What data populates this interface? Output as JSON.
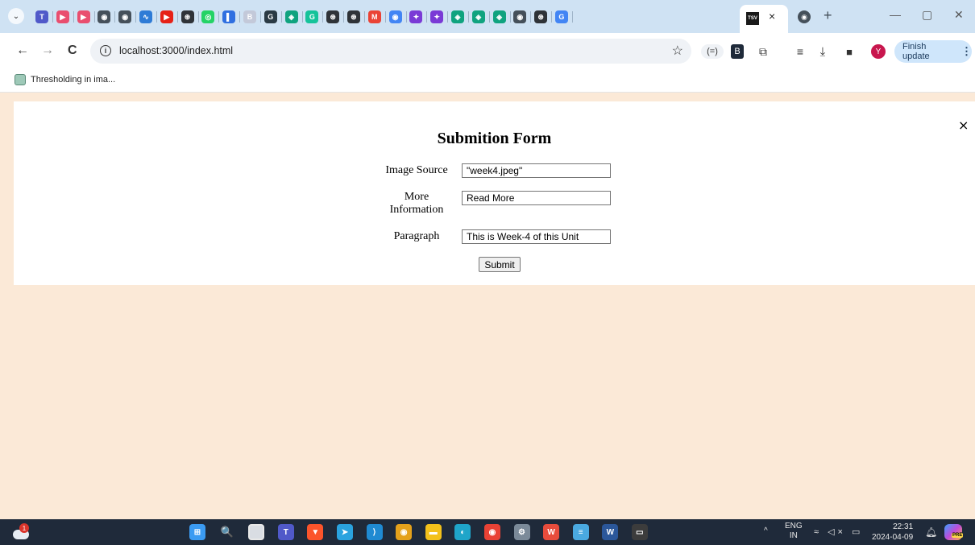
{
  "browser": {
    "tabs": {
      "favicons": [
        {
          "icon": "ms-teams-icon",
          "glyph": "T",
          "color": "#5059c9"
        },
        {
          "icon": "youtube-play-icon",
          "glyph": "▶",
          "color": "#e94e6f"
        },
        {
          "icon": "youtube-play-icon",
          "glyph": "▶",
          "color": "#e94e6f"
        },
        {
          "icon": "globe-icon",
          "glyph": "◉",
          "color": "#45505a"
        },
        {
          "icon": "globe-icon",
          "glyph": "◉",
          "color": "#45505a"
        },
        {
          "icon": "wave-icon",
          "glyph": "∿",
          "color": "#2e7bd6"
        },
        {
          "icon": "youtube-icon",
          "glyph": "▶",
          "color": "#e62117"
        },
        {
          "icon": "openai-icon",
          "glyph": "⊛",
          "color": "#2f3338"
        },
        {
          "icon": "whatsapp-icon",
          "glyph": "◎",
          "color": "#25d366"
        },
        {
          "icon": "bookmark-icon",
          "glyph": "▌",
          "color": "#2f6fe0"
        },
        {
          "icon": "bing-icon",
          "glyph": "B",
          "color": "#c3c9d9"
        },
        {
          "icon": "grammarly-icon",
          "glyph": "G",
          "color": "#2a3a44"
        },
        {
          "icon": "chatgpt-icon",
          "glyph": "◈",
          "color": "#10a37f"
        },
        {
          "icon": "grammarly-icon",
          "glyph": "G",
          "color": "#15c39a"
        },
        {
          "icon": "openai-icon",
          "glyph": "⊛",
          "color": "#2f3338"
        },
        {
          "icon": "openai-icon",
          "glyph": "⊛",
          "color": "#2f3338"
        },
        {
          "icon": "gmail-icon",
          "glyph": "M",
          "color": "#ea4335"
        },
        {
          "icon": "chrome-icon",
          "glyph": "◉",
          "color": "#4285f4"
        },
        {
          "icon": "copilot-icon",
          "glyph": "✦",
          "color": "#7a3ad6"
        },
        {
          "icon": "copilot-icon",
          "glyph": "✦",
          "color": "#7a3ad6"
        },
        {
          "icon": "chatgpt-icon",
          "glyph": "◈",
          "color": "#10a37f"
        },
        {
          "icon": "chatgpt-icon",
          "glyph": "◈",
          "color": "#10a37f"
        },
        {
          "icon": "chatgpt-icon",
          "glyph": "◈",
          "color": "#10a37f"
        },
        {
          "icon": "globe-icon",
          "glyph": "◉",
          "color": "#45505a"
        },
        {
          "icon": "openai-icon",
          "glyph": "⊛",
          "color": "#2f3338"
        },
        {
          "icon": "google-icon",
          "glyph": "G",
          "color": "#4285f4"
        }
      ],
      "active_tab": {
        "favicon_text": "TSV",
        "close": "×"
      },
      "new_tab": "+",
      "window_controls": {
        "minimize": "—",
        "restore": "▢",
        "close": "✕"
      }
    },
    "toolbar": {
      "back": "←",
      "forward": "→",
      "reload": "C",
      "url": "localhost:3000/index.html",
      "star": "☆",
      "finish_update": "Finish update",
      "finish_update_menu": "⋮",
      "profile_initial": "Y"
    },
    "bookmarks": {
      "items": [
        {
          "label": "Thresholding in ima..."
        }
      ]
    }
  },
  "form": {
    "title": "Submition Form",
    "close": "×",
    "fields": [
      {
        "label": "Image Source",
        "value": "\"week4.jpeg\""
      },
      {
        "label": "More Information",
        "value": "Read More"
      },
      {
        "label": "Paragraph",
        "value": "This is Week-4 of this Unit"
      }
    ],
    "submit_label": "Submit"
  },
  "taskbar": {
    "weather_badge": "1",
    "apps": [
      {
        "icon": "windows-start-icon",
        "color": "#3b9bf2",
        "glyph": "⊞"
      },
      {
        "icon": "search-icon",
        "color": "transparent",
        "glyph": "🔍"
      },
      {
        "icon": "task-view-icon",
        "color": "#ffffff",
        "glyph": ""
      },
      {
        "icon": "teams-icon",
        "color": "#5059c9",
        "glyph": "T"
      },
      {
        "icon": "brave-icon",
        "color": "#fb542b",
        "glyph": "▼"
      },
      {
        "icon": "telegram-icon",
        "color": "#2aa3df",
        "glyph": "➤"
      },
      {
        "icon": "vscode-icon",
        "color": "#1f8ad2",
        "glyph": "⟩"
      },
      {
        "icon": "chrome-icon",
        "color": "#e4a11b",
        "glyph": "◉"
      },
      {
        "icon": "file-explorer-icon",
        "color": "#f3c11b",
        "glyph": "▬"
      },
      {
        "icon": "edge-icon",
        "color": "#1fa5c9",
        "glyph": "◐"
      },
      {
        "icon": "chrome-profile-icon",
        "color": "#e94235",
        "glyph": "◉"
      },
      {
        "icon": "settings-icon",
        "color": "#7b8a99",
        "glyph": "⚙"
      },
      {
        "icon": "wps-office-icon",
        "color": "#e74c3c",
        "glyph": "W"
      },
      {
        "icon": "notepad-icon",
        "color": "#4aa9e0",
        "glyph": "≡"
      },
      {
        "icon": "word-icon",
        "color": "#2b579a",
        "glyph": "W"
      },
      {
        "icon": "terminal-icon",
        "color": "#3c3c3c",
        "glyph": "▭"
      }
    ],
    "tray": {
      "caret": "^",
      "lang": "ENG",
      "region": "IN",
      "time": "22:31",
      "date": "2024-04-09",
      "copilot_badge": "PRE"
    }
  }
}
